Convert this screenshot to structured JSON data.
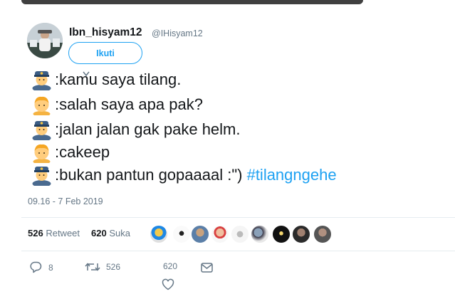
{
  "tweet": {
    "author": {
      "name": "Ibn_hisyam12",
      "handle": "@IHisyam12"
    },
    "follow_label": "Ikuti",
    "lines": [
      {
        "speaker": "police-officer",
        "text": ":kamu saya tilang."
      },
      {
        "speaker": "person",
        "text": ":salah saya apa pak?"
      },
      {
        "speaker": "police-officer",
        "text": ":jalan jalan gak pake helm."
      },
      {
        "speaker": "person",
        "text": ":cakeep"
      },
      {
        "speaker": "police-officer",
        "text": ":bukan pantun gopaaaal :\") ",
        "hashtag": "#tilangngehe"
      }
    ],
    "timestamp": "09.16 - 7 Feb 2019",
    "stats": {
      "retweets_count": "526",
      "retweets_label": "Retweet",
      "likes_count": "620",
      "likes_label": "Suka"
    },
    "actions": {
      "replies": "8",
      "retweets": "526",
      "likes": "620"
    },
    "colors": {
      "accent": "#1da1f2",
      "text": "#14171a",
      "muted": "#657786",
      "divider": "#e6ecf0"
    }
  }
}
